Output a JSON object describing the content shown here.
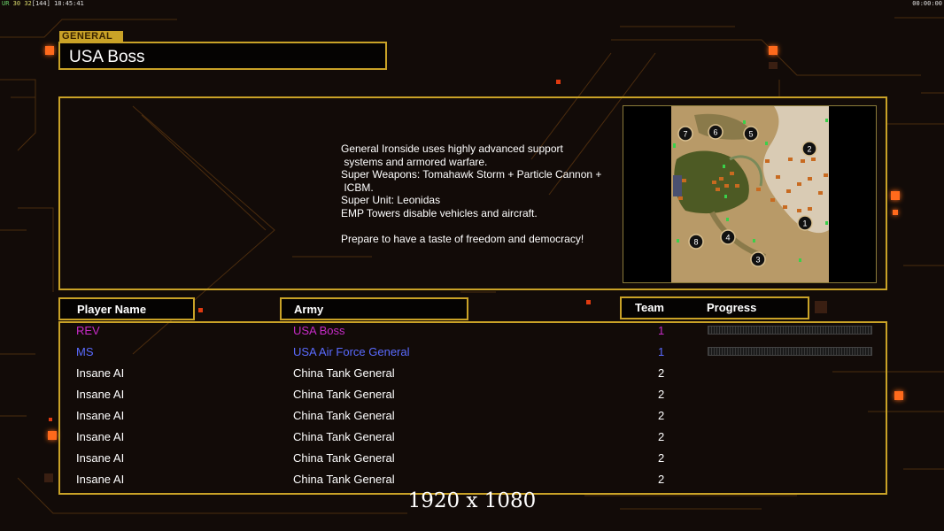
{
  "hud": {
    "fps_label": "UR",
    "fps": "30",
    "frame": "32",
    "bracket": "[144]",
    "clock": "18:45:41",
    "timer": "00:00:00"
  },
  "general": {
    "tag": "GENERAL",
    "name": "USA Boss"
  },
  "description": "General Ironside uses highly advanced support\n systems and armored warfare.\nSuper Weapons: Tomahawk Storm + Particle Cannon +\n ICBM.\nSuper Unit: Leonidas\nEMP Towers disable vehicles and aircraft.\n\nPrepare to have a taste of freedom and democracy!",
  "columns": {
    "player": "Player Name",
    "army": "Army",
    "team": "Team",
    "progress": "Progress"
  },
  "players": [
    {
      "name": "REV",
      "army": "USA Boss",
      "team": "1",
      "color": "#c62bc6",
      "progress": true
    },
    {
      "name": "MS",
      "army": "USA Air Force General",
      "team": "1",
      "color": "#5a6bff",
      "progress": true
    },
    {
      "name": "Insane AI",
      "army": "China Tank General",
      "team": "2",
      "color": "#ffffff",
      "progress": false
    },
    {
      "name": "Insane AI",
      "army": "China Tank General",
      "team": "2",
      "color": "#ffffff",
      "progress": false
    },
    {
      "name": "Insane AI",
      "army": "China Tank General",
      "team": "2",
      "color": "#ffffff",
      "progress": false
    },
    {
      "name": "Insane AI",
      "army": "China Tank General",
      "team": "2",
      "color": "#ffffff",
      "progress": false
    },
    {
      "name": "Insane AI",
      "army": "China Tank General",
      "team": "2",
      "color": "#ffffff",
      "progress": false
    },
    {
      "name": "Insane AI",
      "army": "China Tank General",
      "team": "2",
      "color": "#ffffff",
      "progress": false
    }
  ],
  "map": {
    "start_positions": [
      "1",
      "2",
      "3",
      "4",
      "5",
      "6",
      "7",
      "8"
    ]
  },
  "resolution": "1920 x 1080",
  "colors": {
    "accent": "#c9a227",
    "glow": "#ff6a1a"
  }
}
